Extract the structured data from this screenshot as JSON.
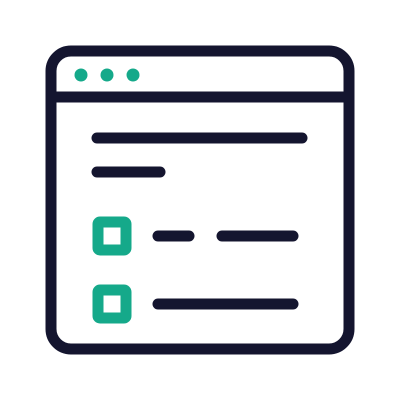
{
  "icon": {
    "name": "browser-window-checklist-icon",
    "colors": {
      "stroke": "#14152f",
      "accent": "#15a98a",
      "background": "#ffffff"
    },
    "window_control_dots": 3,
    "text_lines": 2,
    "checklist_items": [
      {
        "checked": false,
        "label_segments": 2
      },
      {
        "checked": false,
        "label_segments": 1
      }
    ]
  }
}
